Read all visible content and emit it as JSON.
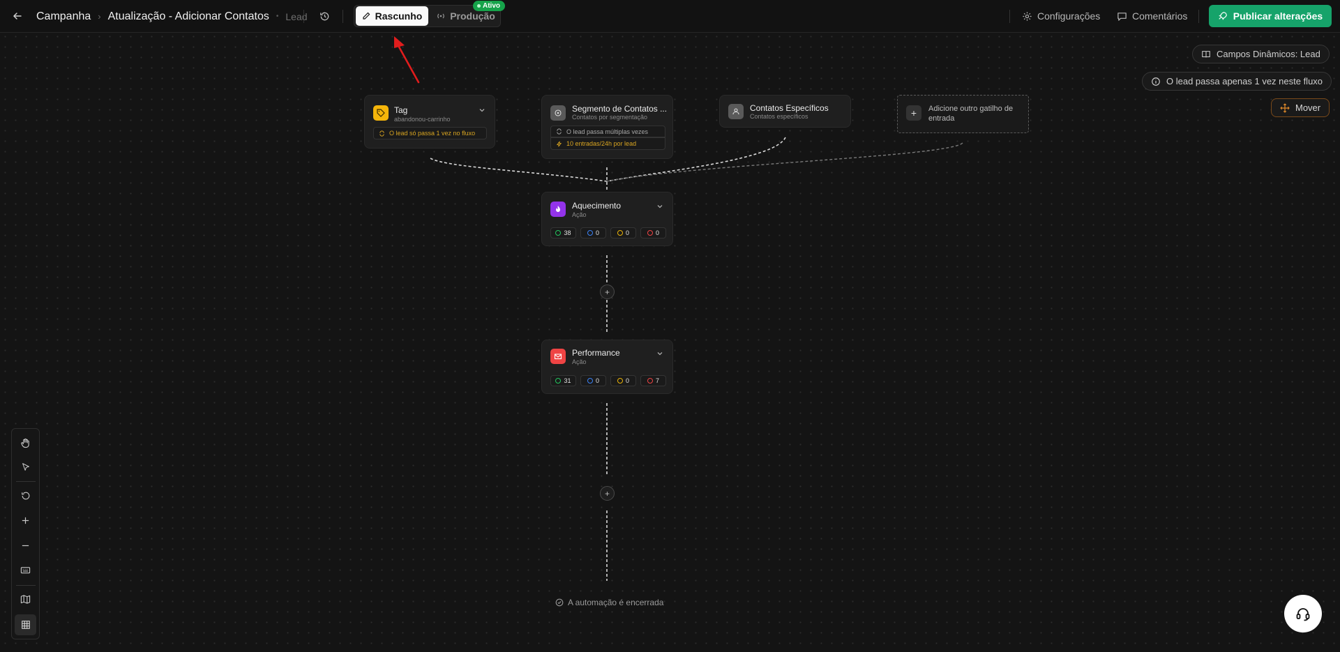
{
  "header": {
    "breadcrumb": [
      "Campanha",
      "Atualização - Adicionar Contatos"
    ],
    "entity": "Lead",
    "mode_draft": "Rascunho",
    "mode_production": "Produção",
    "production_badge": "Ativo",
    "settings_label": "Configurações",
    "comments_label": "Comentários",
    "publish_label": "Publicar alterações"
  },
  "info": {
    "dynamic_fields": "Campos Dinâmicos: Lead",
    "flow_rule": "O lead passa apenas 1 vez neste fluxo",
    "move_label": "Mover"
  },
  "triggers": {
    "tag": {
      "title": "Tag",
      "subtitle": "abandonou-carrinho",
      "rule": "O lead só passa 1 vez no fluxo"
    },
    "segment": {
      "title": "Segmento de Contatos ...",
      "subtitle": "Contatos por segmentação",
      "rule": "O lead passa múltiplas vezes",
      "limit": "10 entradas/24h por lead"
    },
    "specific": {
      "title": "Contatos Específicos",
      "subtitle": "Contatos específicos"
    },
    "add_trigger": "Adicione outro gatilho de entrada"
  },
  "actions": [
    {
      "title": "Aquecimento",
      "subtitle": "Ação",
      "stats": [
        "38",
        "0",
        "0",
        "0"
      ]
    },
    {
      "title": "Performance",
      "subtitle": "Ação",
      "stats": [
        "31",
        "0",
        "0",
        "7"
      ]
    }
  ],
  "end_label": "A automação é encerrada",
  "colors": {
    "publish": "#16a36a",
    "active_badge": "#16a34a",
    "tag_icon": "#f5b50a",
    "aquecimento_icon": "#9333ea",
    "performance_icon": "#ef4444",
    "annotation": "#e11d1d",
    "stat_success": "#22c55e",
    "stat_info": "#3b82f6",
    "stat_warning": "#eab308",
    "stat_error": "#ef4444"
  },
  "icons": {
    "toolbar": [
      "hand-icon",
      "pointer-icon",
      "reset-icon",
      "zoom-in-icon",
      "zoom-out-icon",
      "keyboard-icon",
      "map-icon",
      "grid-icon"
    ]
  }
}
